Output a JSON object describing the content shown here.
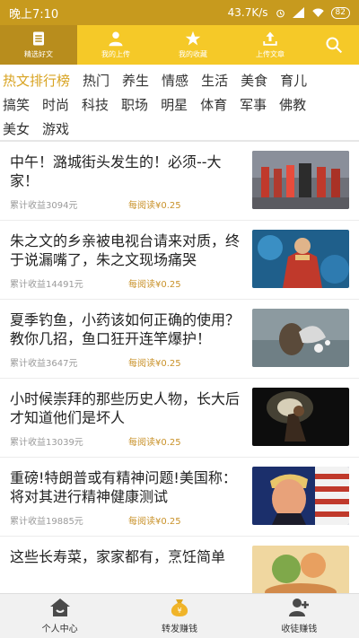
{
  "status_bar": {
    "time": "晚上7:10",
    "speed": "43.7K/s",
    "battery": "82"
  },
  "top_nav": {
    "items": [
      {
        "label": "精选好文",
        "icon": "document-icon",
        "active": true
      },
      {
        "label": "我的上传",
        "icon": "user-icon",
        "active": false
      },
      {
        "label": "我的收藏",
        "icon": "star-icon",
        "active": false
      },
      {
        "label": "上传文章",
        "icon": "upload-icon",
        "active": false
      }
    ],
    "search_icon": "search-icon"
  },
  "categories": {
    "rows": [
      [
        "热文排行榜",
        "热门",
        "养生",
        "情感",
        "生活",
        "美食",
        "育儿"
      ],
      [
        "搞笑",
        "时尚",
        "科技",
        "职场",
        "明星",
        "体育",
        "军事",
        "佛教"
      ],
      [
        "美女",
        "游戏"
      ]
    ],
    "active": "热文排行榜",
    "active_color": "#d8a321"
  },
  "articles": [
    {
      "title": "中午！潞城街头发生的！必须--大家！",
      "earnings": "累计收益3094元",
      "reward": "每阅读¥0.25"
    },
    {
      "title": "朱之文的乡亲被电视台请来对质，终于说漏嘴了，朱之文现场痛哭",
      "earnings": "累计收益14491元",
      "reward": "每阅读¥0.25"
    },
    {
      "title": "夏季钓鱼，小药该如何正确的使用？教你几招，鱼口狂开连竿爆护！",
      "earnings": "累计收益3647元",
      "reward": "每阅读¥0.25"
    },
    {
      "title": "小时候崇拜的那些历史人物，长大后才知道他们是坏人",
      "earnings": "累计收益13039元",
      "reward": "每阅读¥0.25"
    },
    {
      "title": "重磅!特朗普或有精神问题!美国称：将对其进行精神健康测试",
      "earnings": "累计收益19885元",
      "reward": "每阅读¥0.25"
    },
    {
      "title": "这些长寿菜，家家都有，烹饪简单",
      "earnings": "",
      "reward": ""
    }
  ],
  "bottom_nav": {
    "items": [
      {
        "label": "个人中心",
        "icon": "home-icon"
      },
      {
        "label": "转发赚钱",
        "icon": "money-bag-icon"
      },
      {
        "label": "收徒赚钱",
        "icon": "add-user-icon"
      }
    ]
  },
  "colors": {
    "status_bar": "#c79a1e",
    "nav": "#f5c928",
    "nav_active": "#b88d1d",
    "reward": "#c9922a"
  }
}
